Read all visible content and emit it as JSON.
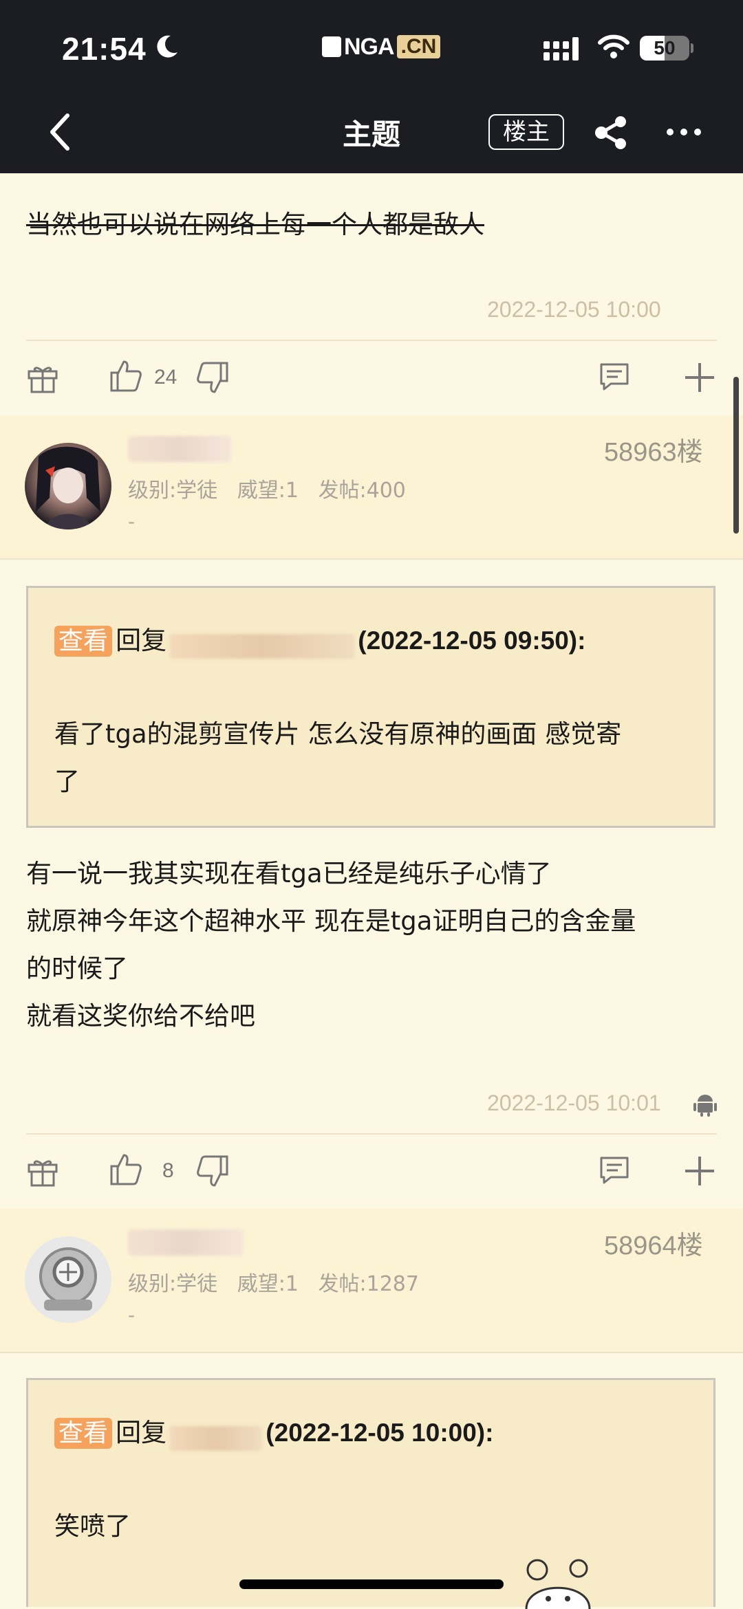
{
  "status": {
    "time": "21:54",
    "battery": "50",
    "battery_level": 0.5
  },
  "app": {
    "logo_main": "NGA",
    "logo_suffix": ".CN"
  },
  "nav": {
    "title": "主题",
    "op_button": "楼主"
  },
  "colors": {
    "topbar": "#1c1d22",
    "page_bg": "#fdf8e4",
    "user_band": "#fcf3d5",
    "view_tag": "#f5a25d",
    "quote_bg": "#f7ebc8"
  },
  "posts": [
    {
      "body_lines": [
        "当然也可以说在网络上每一个人都是敌人"
      ],
      "timestamp": "2022-12-05 10:00",
      "likes": "24"
    },
    {
      "floor": "58963楼",
      "stats": "级别:学徒   威望:1   发帖:400",
      "dash": "-",
      "quote": {
        "tag": "查看",
        "reply_label": "回复",
        "reply_time": "(2022-12-05 09:50):",
        "text_lines": [
          "看了tga的混剪宣传片 怎么没有原神的画面 感觉寄",
          "了"
        ]
      },
      "body_lines": [
        "有一说一我其实现在看tga已经是纯乐子心情了",
        "就原神今年这个超神水平 现在是tga证明自己的含金量",
        "的时候了",
        "就看这奖你给不给吧"
      ],
      "timestamp": "2022-12-05 10:01",
      "likes": "8"
    },
    {
      "floor": "58964楼",
      "stats": "级别:学徒   威望:1   发帖:1287",
      "dash": "-",
      "quote": {
        "tag": "查看",
        "reply_label": "回复",
        "reply_time": "(2022-12-05 10:00):",
        "text_lines": [
          "笑喷了"
        ]
      }
    }
  ],
  "icons": [
    "back-icon",
    "share-icon",
    "more-icon",
    "gift-icon",
    "thumb-up-icon",
    "thumb-down-icon",
    "comment-icon",
    "plus-icon",
    "android-icon",
    "moon-icon",
    "signal-icon",
    "wifi-icon"
  ]
}
